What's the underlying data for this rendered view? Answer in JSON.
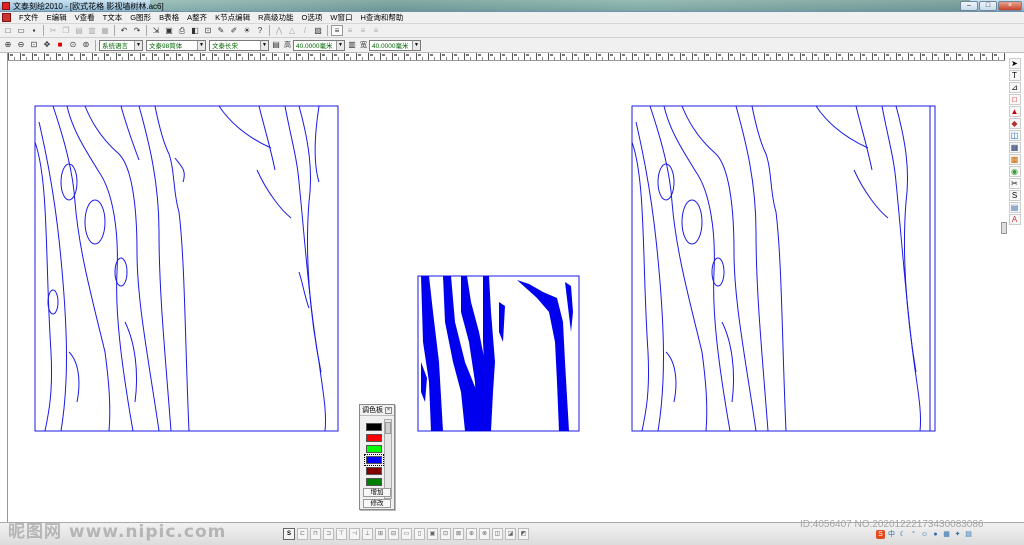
{
  "window": {
    "title": "文泰刻绘2010 - [欧式花格 影视墙树林.ac6]",
    "buttons": {
      "minimize": "–",
      "maximize": "□",
      "close": "×"
    }
  },
  "menu": [
    "F文件",
    "E编辑",
    "V查看",
    "T文本",
    "G图形",
    "B表格",
    "A整齐",
    "K节点编辑",
    "R高级功能",
    "O选项",
    "W窗口",
    "H查询和帮助"
  ],
  "toolbar2": {
    "language": "系统语言",
    "font1": "文泰98简体",
    "font2": "文泰长宋",
    "height_label": "高",
    "height_value": "40.0000毫米",
    "width_label": "宽",
    "width_value": "40.0000毫米"
  },
  "palette": {
    "title": "调色板",
    "close": "×",
    "colors": [
      "#000000",
      "#ff0000",
      "#00ff00",
      "#0000ff",
      "#800000",
      "#008000"
    ],
    "selected_index": 3,
    "add_label": "增加",
    "modify_label": "修改"
  },
  "watermark": {
    "left": "昵图网 www.nipic.com",
    "right": "ID:4056407 NO:20201222173430083086"
  },
  "ime": {
    "logo": "S",
    "lang": "中"
  }
}
